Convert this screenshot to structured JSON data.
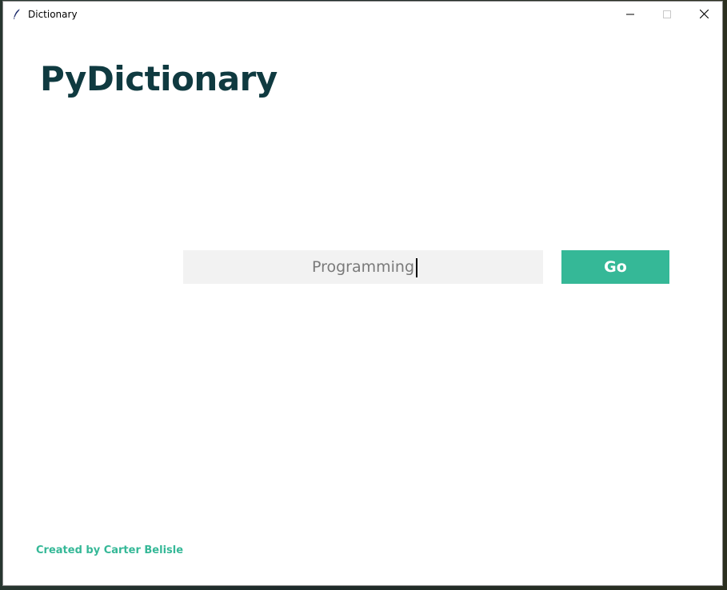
{
  "window": {
    "title": "Dictionary",
    "app_icon": "feather-icon",
    "controls": {
      "minimize_icon": "minimize-icon",
      "maximize_icon": "maximize-icon",
      "close_icon": "close-icon"
    }
  },
  "main": {
    "heading": "PyDictionary",
    "search": {
      "value": "Programming",
      "placeholder": ""
    },
    "go_label": "Go"
  },
  "footer": {
    "credit": "Created by Carter Belisle"
  },
  "colors": {
    "heading": "#0f3a40",
    "accent": "#35b897",
    "input_background": "#f2f2f2",
    "input_text": "#7a7a7a"
  }
}
